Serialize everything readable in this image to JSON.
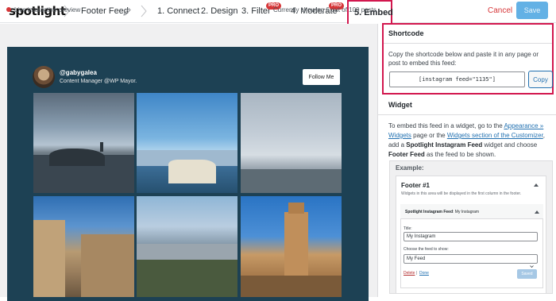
{
  "topbar": {
    "logo": "spotlight",
    "feed_name": "Footer Feed",
    "steps": [
      {
        "label": "1. Connect",
        "pro": ""
      },
      {
        "label": "2. Design",
        "pro": ""
      },
      {
        "label": "3. Filter",
        "pro": "PRO"
      },
      {
        "label": "4. Moderate",
        "pro": "PRO"
      },
      {
        "label": "5. Embed",
        "pro": ""
      }
    ],
    "cancel_label": "Cancel",
    "save_label": "Save"
  },
  "preview": {
    "live_label": "Live interactive preview",
    "showing_label": "Currently showing 6 out of 100 posts",
    "username": "@gabygalea",
    "bio": "Content Manager @WP Mayor.",
    "follow_label": "Follow Me"
  },
  "shortcode": {
    "title": "Shortcode",
    "description": "Copy the shortcode below and paste it in any page or post to embed this feed:",
    "value": "[instagram feed=\"1135\"]",
    "copy_label": "Copy"
  },
  "widget": {
    "title": "Widget",
    "desc_1": "To embed this feed in a widget, go to the ",
    "link_appearance": "Appearance » Widgets",
    "desc_2": " page or the ",
    "link_customizer": "Widgets section of the Customizer",
    "desc_3": ", add a ",
    "bold_widget": "Spotlight Instagram Feed",
    "desc_4": " widget and choose ",
    "bold_feed": "Footer Feed",
    "desc_5": " as the feed to be shown.",
    "example_label": "Example:",
    "footer_title": "Footer #1",
    "footer_desc": "Widgets in this area will be displayed in the first column in the footer.",
    "inner_head_bold": "Spotlight Instagram Feed",
    "inner_head_rest": ": My Instagram",
    "title_label": "Title:",
    "title_value": "My Instagram",
    "choose_label": "Choose the feed to show:",
    "choose_value": "My Feed",
    "delete_label": "Delete",
    "sep": "|",
    "done_label": "Done",
    "saved_label": "Saved"
  },
  "colors": {
    "accent_highlight": "#d2174e",
    "feed_background": "#1d4154",
    "link": "#2271b1",
    "save_button": "#63b1e5"
  }
}
